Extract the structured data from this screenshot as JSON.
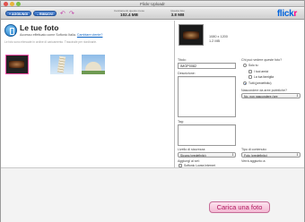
{
  "window": {
    "title": "Flickr Uploadr"
  },
  "toolbar": {
    "add_label": "+ AGGIUNGI",
    "remove_label": "– RIMUOVI",
    "rotate_left_icon": "rotate-left-icon",
    "rotate_right_icon": "rotate-right-icon",
    "quota_label": "Caricamenti questo mese",
    "quota_value": "102.4 MB",
    "selected_label": "Questa foto",
    "selected_value": "3.8 MB",
    "logo_left": "flick",
    "logo_right": "r"
  },
  "left": {
    "title": "Le tue foto",
    "subtitle_prefix": "Accesso effettuato come Softonic Italia.",
    "subtitle_link": "Cambiare utente?",
    "hint": "Le foto sono elencate in ordine di caricamento. Trascinale per riordinarle."
  },
  "photo": {
    "dimensions": "1080 x 1200",
    "size": "1.2 MB",
    "title_label": "Titolo:",
    "title_value": "IMGP0082",
    "description_label": "Descrizione:",
    "tags_label": "Tag:",
    "safety_label": "Livello di sicurezza:",
    "safety_value": "Sicura (predefinito)",
    "add_to_set_label": "Aggiungi ai set:",
    "set_option": "Softonic Lovea Internet",
    "visibility_label": "Chi può vedere queste foto?",
    "visibility_options": [
      "Solo tu",
      "I tuoi amici",
      "La tua famiglia",
      "Tutti (predefinito)"
    ],
    "hide_label": "Nascondere da aree pubbliche?",
    "hide_value": "No, non nascondere (pre",
    "content_label": "Tipo di contenuto:",
    "content_value": "Foto (predefinito)",
    "group_label": "Verrà aggiunto a:",
    "apply_button": "CREA UN SET"
  },
  "footer": {
    "upload_button": "Carica una foto"
  },
  "colors": {
    "accent_blue": "#2f66b8",
    "flickr_blue": "#0063dc",
    "flickr_pink": "#ff0084",
    "upload_pink": "#b0185f"
  }
}
